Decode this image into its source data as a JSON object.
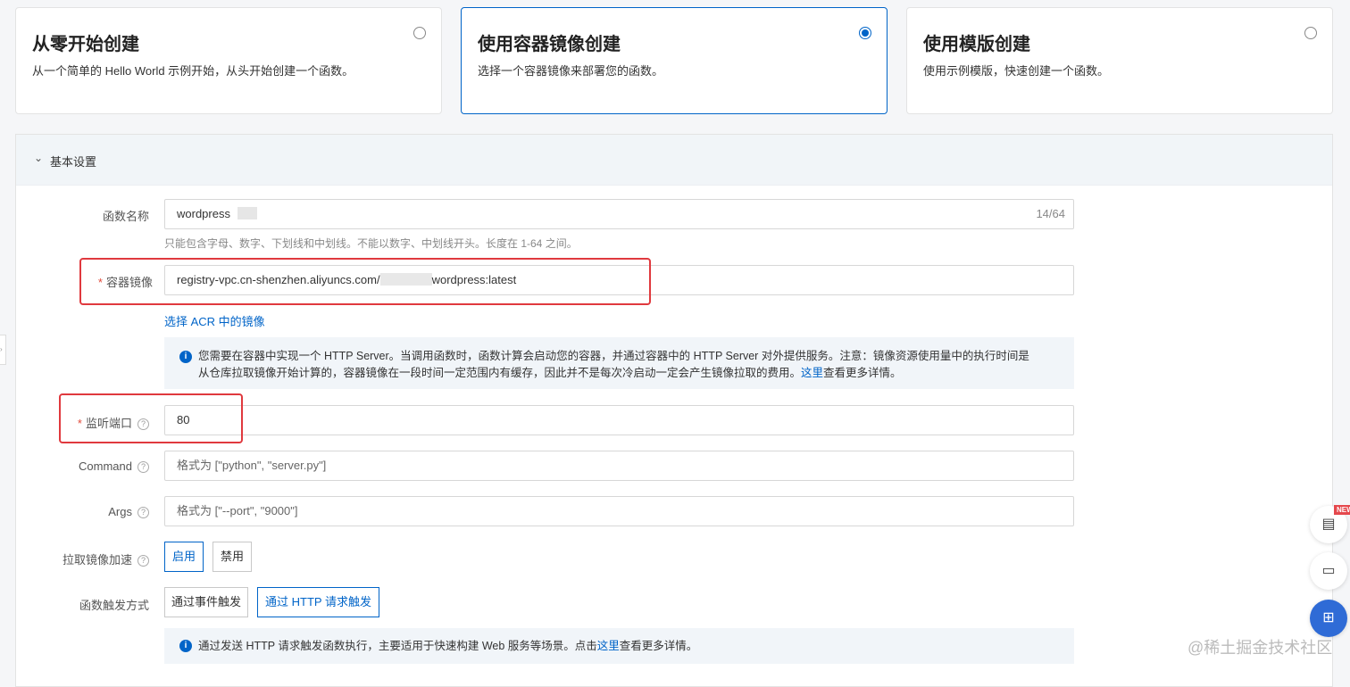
{
  "creation_cards": [
    {
      "title": "从零开始创建",
      "description": "从一个简单的 Hello World 示例开始，从头开始创建一个函数。",
      "selected": false
    },
    {
      "title": "使用容器镜像创建",
      "description": "选择一个容器镜像来部署您的函数。",
      "selected": true
    },
    {
      "title": "使用模版创建",
      "description": "使用示例模版，快速创建一个函数。",
      "selected": false
    }
  ],
  "basic_settings": {
    "title": "基本设置",
    "function_name": {
      "label": "函数名称",
      "value": "wordpress",
      "counter": "14/64",
      "hint": "只能包含字母、数字、下划线和中划线。不能以数字、中划线开头。长度在 1-64 之间。"
    },
    "container_image": {
      "label": "容器镜像",
      "value_prefix": "registry-vpc.cn-shenzhen.aliyuncs.com/",
      "value_suffix": "wordpress:latest",
      "select_link": "选择 ACR 中的镜像",
      "info_line1": "您需要在容器中实现一个 HTTP Server。当调用函数时，函数计算会启动您的容器，并通过容器中的 HTTP Server 对外提供服务。注意：镜像资源使用量中的执行时间是",
      "info_line2_prefix": "从仓库拉取镜像开始计算的，容器镜像在一段时间一定范围内有缓存，因此并不是每次冷启动一定会产生镜像拉取的费用。",
      "info_link": "这里",
      "info_line2_suffix": "查看更多详情。"
    },
    "listen_port": {
      "label": "监听端口",
      "value": "80"
    },
    "command": {
      "label": "Command",
      "placeholder": "格式为 [\"python\", \"server.py\"]"
    },
    "args": {
      "label": "Args",
      "placeholder": "格式为 [\"--port\", \"9000\"]"
    },
    "pull_accel": {
      "label": "拉取镜像加速",
      "options": [
        "启用",
        "禁用"
      ],
      "selected": "启用"
    },
    "trigger": {
      "label": "函数触发方式",
      "options": [
        "通过事件触发",
        "通过 HTTP 请求触发"
      ],
      "selected": "通过 HTTP 请求触发",
      "info_prefix": "通过发送 HTTP 请求触发函数执行，主要适用于快速构建 Web 服务等场景。点击",
      "info_link": "这里",
      "info_suffix": "查看更多详情。"
    }
  },
  "floating": {
    "new_badge": "NEW"
  },
  "watermark": "@稀土掘金技术社区",
  "colors": {
    "accent": "#0064c8",
    "highlight": "#e0393e",
    "required": "#e24b3b"
  }
}
